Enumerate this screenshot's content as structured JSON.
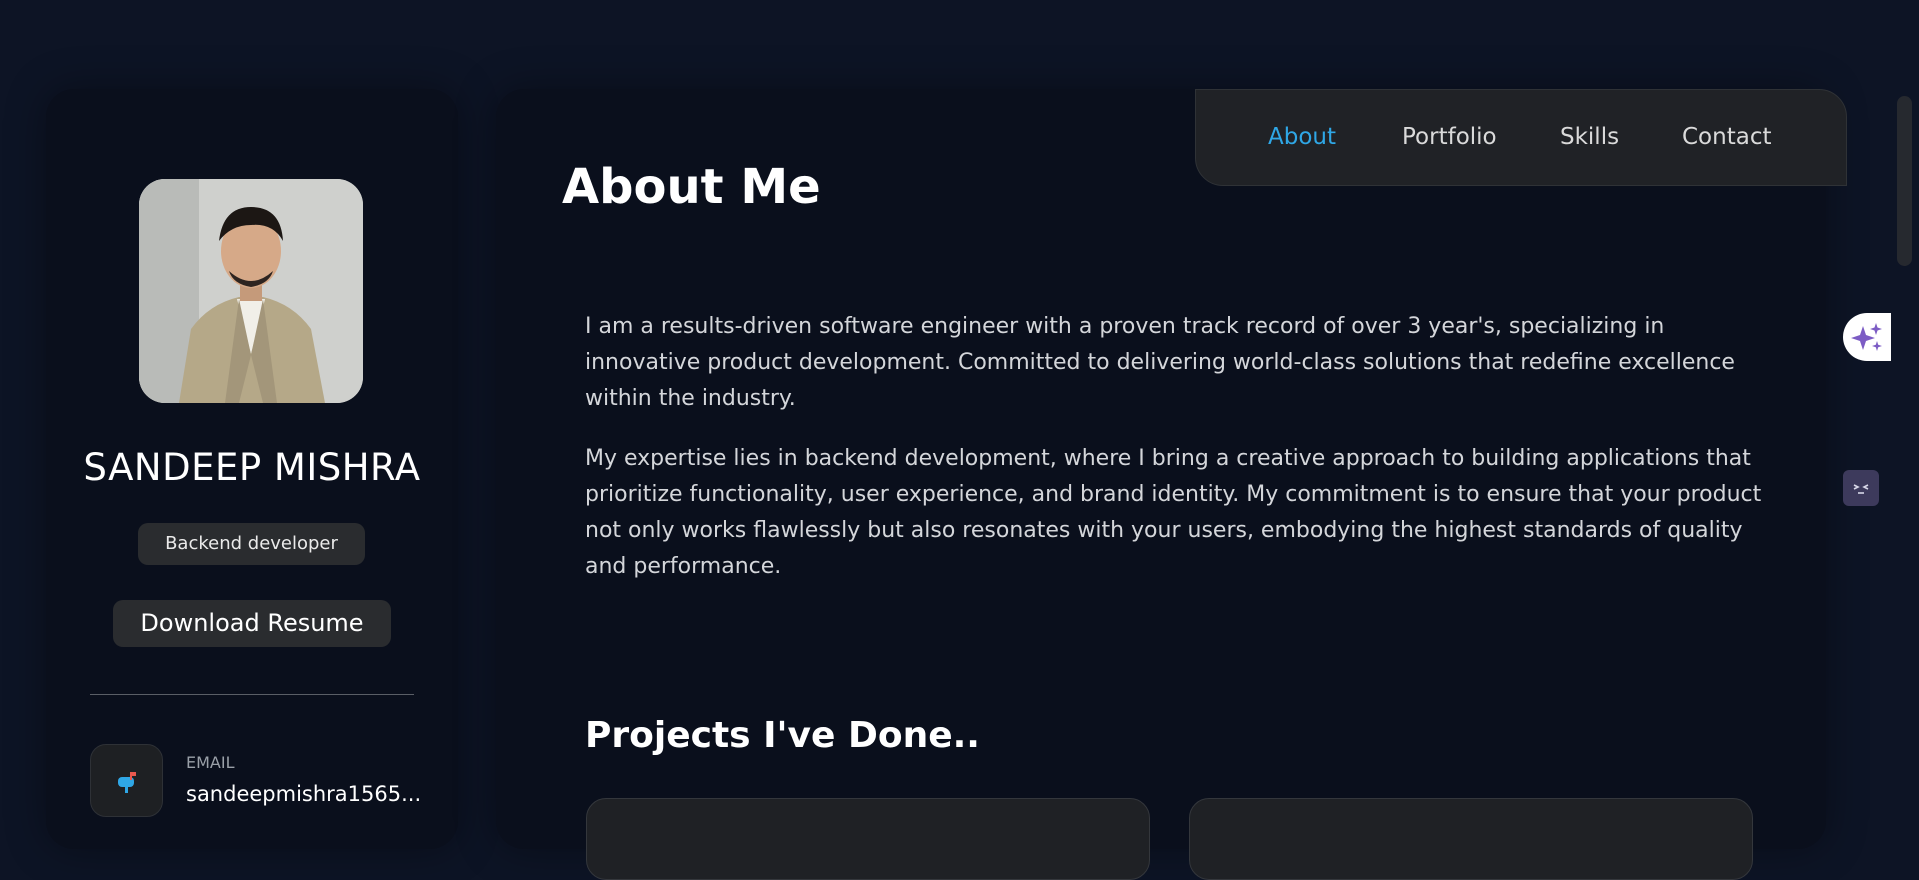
{
  "profile": {
    "name": "SANDEEP MISHRA",
    "role": "Backend developer",
    "resume_button": "Download Resume",
    "contact": {
      "label": "EMAIL",
      "value": "sandeepmishra1565..."
    }
  },
  "nav": {
    "items": [
      {
        "label": "About",
        "active": true
      },
      {
        "label": "Portfolio",
        "active": false
      },
      {
        "label": "Skills",
        "active": false
      },
      {
        "label": "Contact",
        "active": false
      }
    ]
  },
  "about": {
    "title": "About Me",
    "paragraphs": [
      "I am a results-driven software engineer with a proven track record of over 3 year's, specializing in innovative product development. Committed to delivering world-class solutions that redefine excellence within the industry.",
      "My expertise lies in backend development, where I bring a creative approach to building applications that prioritize functionality, user experience, and brand identity. My commitment is to ensure that your product not only works flawlessly but also resonates with your users, embodying the highest standards of quality and performance."
    ]
  },
  "projects": {
    "title": "Projects I've Done.."
  },
  "icons": {
    "contact_icon": "mailbox-icon",
    "ai_button_icon": "sparkles-icon",
    "mini_button_icon": "face-icon"
  },
  "colors": {
    "accent": "#2fa7e6",
    "background": "#0d1425",
    "card": "#0a0f1c",
    "badge": "#2a2c2f"
  }
}
